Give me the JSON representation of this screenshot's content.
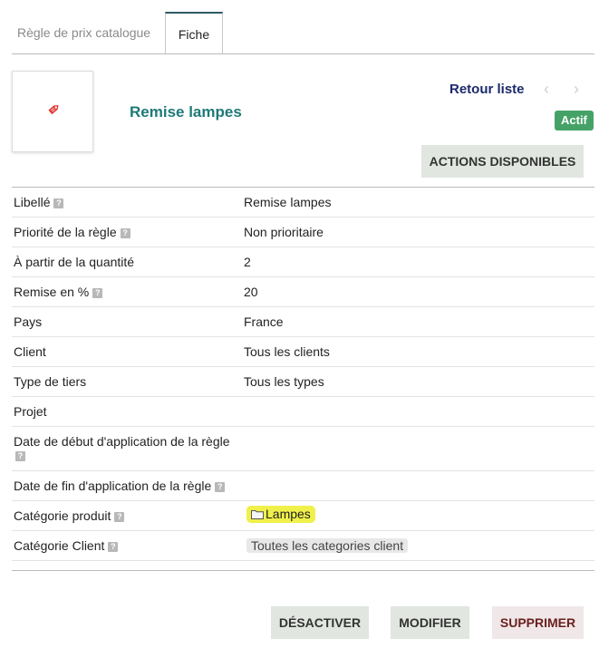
{
  "tabs": [
    {
      "label": "Règle de prix catalogue",
      "active": false
    },
    {
      "label": "Fiche",
      "active": true
    }
  ],
  "banner": {
    "ref": "Remise lampes",
    "back_label": "Retour liste",
    "prev_icon": "chevron-left-icon",
    "next_icon": "chevron-right-icon",
    "status": "Actif",
    "status_color": "#45a267",
    "actions_label": "ACTIONS DISPONIBLES",
    "photo_icon": "price-tag-icon"
  },
  "fields": [
    {
      "label": "Libellé",
      "help": true,
      "value": "Remise lampes"
    },
    {
      "label": "Priorité de la règle",
      "help": true,
      "value": "Non prioritaire"
    },
    {
      "label": "À partir de la quantité",
      "help": false,
      "value": "2"
    },
    {
      "label": "Remise en %",
      "help": true,
      "value": "20"
    },
    {
      "label": "Pays",
      "help": false,
      "value": "France"
    },
    {
      "label": "Client",
      "help": false,
      "value": "Tous les clients"
    },
    {
      "label": "Type de tiers",
      "help": false,
      "value": "Tous les types"
    },
    {
      "label": "Projet",
      "help": false,
      "value": ""
    },
    {
      "label": "Date de début d'application de la règle",
      "help": true,
      "value": ""
    },
    {
      "label": "Date de fin d'application de la règle",
      "help": true,
      "value": ""
    },
    {
      "label": "Catégorie produit",
      "help": true,
      "value": "Lampes"
    },
    {
      "label": "Catégorie Client",
      "help": true,
      "value": "Toutes les categories client"
    }
  ],
  "help_glyph": "?",
  "buttons": {
    "deactivate": "DÉSACTIVER",
    "modify": "MODIFIER",
    "delete": "SUPPRIMER"
  },
  "colors": {
    "accent_title": "#1e7a78",
    "link": "#1c2a6b",
    "category_highlight": "#f0f04a",
    "delete_text": "#6b1f1f"
  }
}
